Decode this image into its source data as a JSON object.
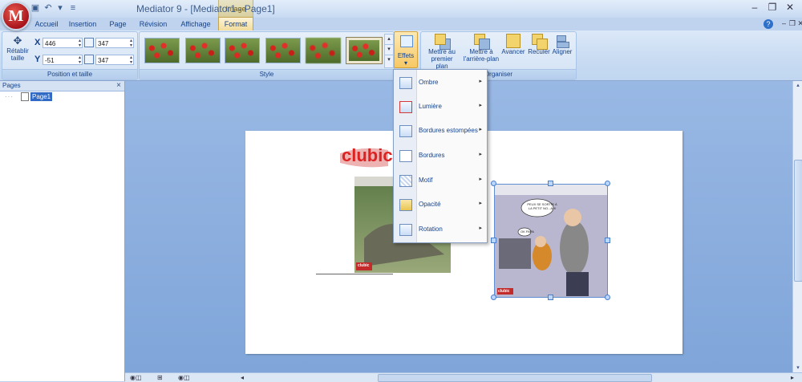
{
  "window": {
    "title": "Mediator 9 - [Mediator1 - Page1]",
    "context_tab_group": "Image",
    "logo_letter": "M"
  },
  "quick_access": {
    "save_icon": "save-icon",
    "undo_icon": "undo-icon",
    "customize_icon": "customize-qat-icon"
  },
  "window_controls": {
    "minimize": "‒",
    "restore": "❐",
    "close": "✕"
  },
  "ribbon": {
    "tabs": [
      {
        "label": "Accueil"
      },
      {
        "label": "Insertion"
      },
      {
        "label": "Page"
      },
      {
        "label": "Révision"
      },
      {
        "label": "Affichage"
      },
      {
        "label": "Format",
        "active": true
      }
    ],
    "help": "?",
    "position_group": {
      "label": "Position et taille",
      "reset_label": "Rétablir taille",
      "x_label": "X",
      "y_label": "Y",
      "x_value": "446",
      "y_value": "-51",
      "width_value": "347",
      "height_value": "347"
    },
    "style_group": {
      "label": "Style",
      "thumbnails": 7
    },
    "effects_button": {
      "label": "Effets",
      "caret": "▾"
    },
    "arrange_group": {
      "label": "Organiser",
      "buttons": [
        {
          "label": "Mettre au premier plan"
        },
        {
          "label": "Mettre à l'arrière-plan"
        },
        {
          "label": "Avancer"
        },
        {
          "label": "Reculer"
        },
        {
          "label": "Aligner"
        }
      ]
    }
  },
  "effects_menu": {
    "items": [
      {
        "label": "Ombre",
        "icon": "shadow-icon"
      },
      {
        "label": "Lumière",
        "icon": "glow-icon"
      },
      {
        "label": "Bordures estompées",
        "icon": "soft-edges-icon"
      },
      {
        "label": "Bordures",
        "icon": "borders-icon"
      },
      {
        "label": "Motif",
        "icon": "pattern-icon"
      },
      {
        "label": "Opacité",
        "icon": "opacity-icon"
      },
      {
        "label": "Rotation",
        "icon": "rotation-icon"
      }
    ],
    "submenu_arrow": "▸"
  },
  "pages_pane": {
    "title": "Pages",
    "close": "×",
    "items": [
      {
        "label": "Page1"
      }
    ]
  },
  "canvas": {
    "left_image_title": "clubic",
    "right_image_caption_1": "PEUX SE SORTIR À LA PETIT NO...AH!",
    "right_image_caption_2": "OK PAPA",
    "right_image_logo": "clubic",
    "left_image_logo": "clubic"
  },
  "scrollbar": {
    "horizontal_position": 0.4,
    "vertical_position": 0.35
  }
}
